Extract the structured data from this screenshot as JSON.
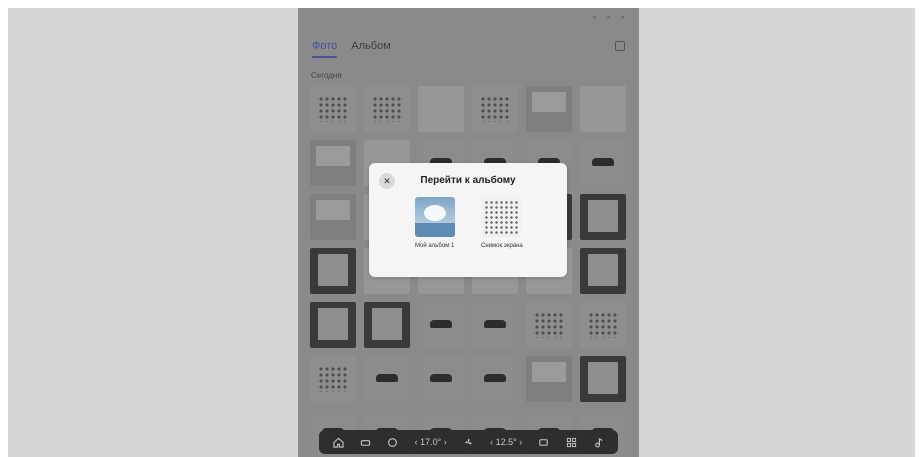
{
  "app": {
    "tabs": [
      {
        "label": "Фото",
        "active": true
      },
      {
        "label": "Альбом",
        "active": false
      }
    ],
    "section_label": "Сегодня",
    "accent_color": "#4a4f9a"
  },
  "gallery": {
    "thumbnail_styles": [
      "t-grid",
      "t-grid",
      "t-light",
      "t-grid",
      "t-doc",
      "t-light",
      "t-doc",
      "t-light",
      "t-car",
      "t-car",
      "t-car",
      "t-car",
      "t-doc",
      "t-light",
      "t-light",
      "t-light",
      "t-dark",
      "t-dark",
      "t-dark",
      "t-light",
      "t-light",
      "t-light",
      "t-light",
      "t-dark",
      "t-dark",
      "t-dark",
      "t-car",
      "t-car",
      "t-grid",
      "t-grid",
      "t-grid",
      "t-car",
      "t-car",
      "t-car",
      "t-doc",
      "t-dark",
      "t-car",
      "t-car",
      "t-car",
      "t-car",
      "t-car",
      "t-car"
    ]
  },
  "modal": {
    "title": "Перейти к альбому",
    "close_icon": "close-icon",
    "albums": [
      {
        "label": "Мой альбом 1",
        "thumbnail": "sky-photo"
      },
      {
        "label": "Снимок экрана",
        "thumbnail": "screenshot-grid"
      }
    ]
  },
  "dock": {
    "temp_left": "17.0°",
    "temp_right": "12.5°",
    "icons": [
      "home-icon",
      "car-icon",
      "steering-heat-icon",
      "fan-icon",
      "seat-heat-icon",
      "apps-icon",
      "music-icon"
    ]
  }
}
